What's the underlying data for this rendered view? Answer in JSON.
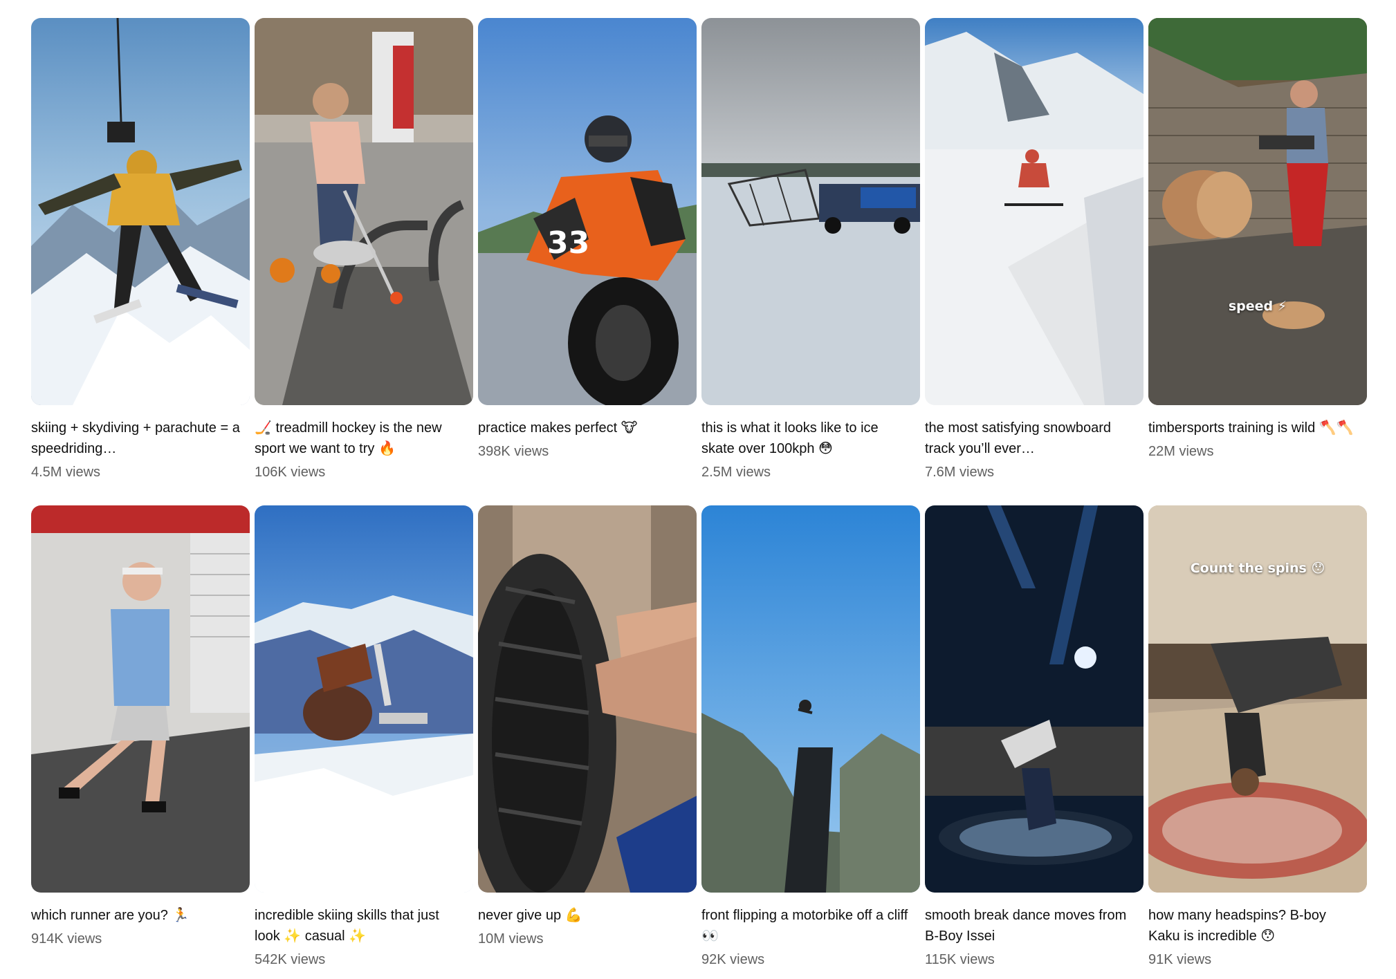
{
  "shorts": [
    {
      "title": "skiing + skydiving + parachute = a speedriding…",
      "views": "4.5M views",
      "icon": "skier-parachute-thumbnail"
    },
    {
      "title": "🏒 treadmill hockey is the new sport we want to try 🔥",
      "views": "106K views",
      "icon": "treadmill-hockey-thumbnail"
    },
    {
      "title": "practice makes perfect 🐮",
      "views": "398K views",
      "icon": "motorbike-thumbnail"
    },
    {
      "title": "this is what it looks like to ice skate over 100kph 😳",
      "views": "2.5M views",
      "icon": "ice-skate-thumbnail"
    },
    {
      "title": "the most satisfying snowboard track you’ll ever…",
      "views": "7.6M views",
      "icon": "snowboard-thumbnail"
    },
    {
      "title": "timbersports training is wild 🪓🪓",
      "views": "22M views",
      "icon": "timbersports-thumbnail",
      "overlay": "speed ⚡"
    },
    {
      "title": "which runner are you? 🏃",
      "views": "914K views",
      "icon": "runner-thumbnail"
    },
    {
      "title": "incredible skiing skills that just look ✨ casual ✨",
      "views": "542K views",
      "icon": "skiing-flip-thumbnail"
    },
    {
      "title": "never give up 💪",
      "views": "10M views",
      "icon": "tire-repair-thumbnail"
    },
    {
      "title": "front flipping a motorbike off a cliff 👀",
      "views": "92K views",
      "icon": "motorbike-cliff-thumbnail"
    },
    {
      "title": "smooth break dance moves from B-Boy Issei",
      "views": "115K views",
      "icon": "breakdance-thumbnail"
    },
    {
      "title": "how many headspins? B-boy Kaku is incredible 😯",
      "views": "91K views",
      "icon": "headspin-thumbnail",
      "overlay": "Count the spins 😯"
    }
  ],
  "colors": {
    "title": "#0f0f0f",
    "views": "#606060",
    "background": "#ffffff"
  }
}
